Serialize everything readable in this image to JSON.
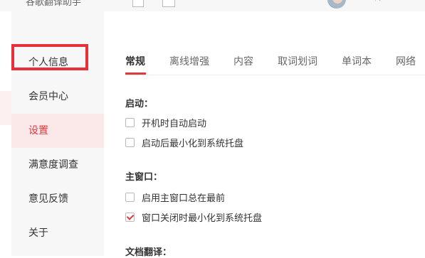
{
  "background_app": {
    "title": "谷歌翻译助手"
  },
  "sidebar": {
    "items": [
      {
        "label": "个人信息",
        "active": false
      },
      {
        "label": "会员中心",
        "active": false
      },
      {
        "label": "设置",
        "active": true
      },
      {
        "label": "满意度调查",
        "active": false
      },
      {
        "label": "意见反馈",
        "active": false
      },
      {
        "label": "关于",
        "active": false
      }
    ]
  },
  "tabs": [
    {
      "label": "常规",
      "active": true
    },
    {
      "label": "离线增强",
      "active": false
    },
    {
      "label": "内容",
      "active": false
    },
    {
      "label": "取词划词",
      "active": false
    },
    {
      "label": "单词本",
      "active": false
    },
    {
      "label": "网络",
      "active": false
    }
  ],
  "sections": {
    "startup": {
      "title": "启动：",
      "options": [
        {
          "label": "开机时自动启动",
          "checked": false
        },
        {
          "label": "启动后最小化到系统托盘",
          "checked": false
        }
      ]
    },
    "main_window": {
      "title": "主窗口：",
      "options": [
        {
          "label": "启用主窗口总在最前",
          "checked": false
        },
        {
          "label": "窗口关闭时最小化到系统托盘",
          "checked": true
        }
      ]
    },
    "doc_translate": {
      "title": "文档翻译："
    }
  },
  "colors": {
    "accent": "#e0383e",
    "annotation": "#e8303a",
    "sidebar_bg": "#f7f7f7",
    "active_bg": "#fbe9e9"
  }
}
